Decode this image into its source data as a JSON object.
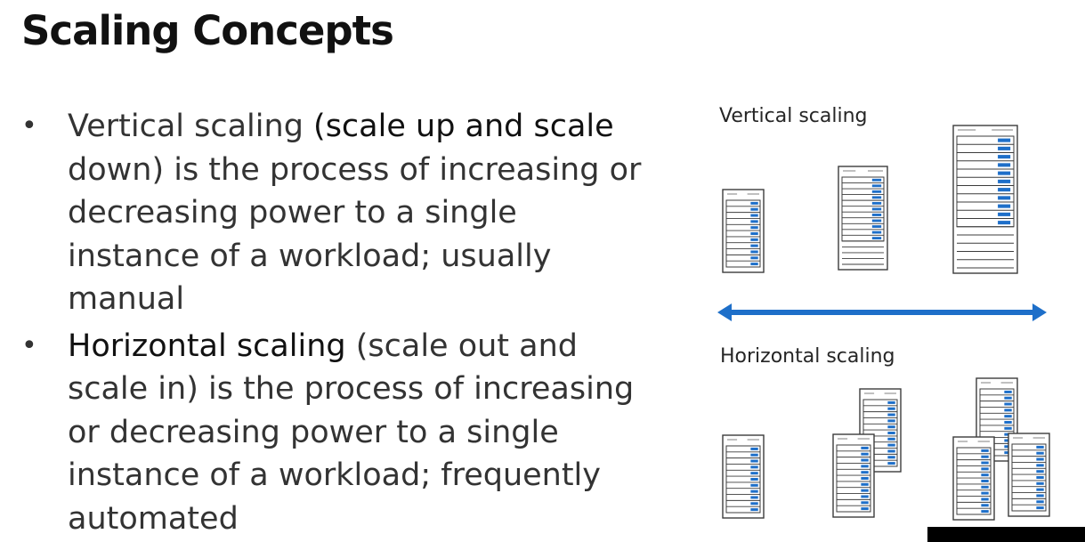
{
  "slide": {
    "title": "Scaling Concepts",
    "bullets": [
      {
        "lead": "Vertical scaling ",
        "term": "(scale up and scale",
        "rest": " down) is the process of increasing or decreasing power to a single instance of a workload; usually manual"
      },
      {
        "lead": "",
        "term": "Horizontal scaling",
        "rest": " (scale out and scale in) is the process of increasing or decreasing power to a single instance of a workload; frequently automated"
      }
    ],
    "bullet_glyph": "•"
  },
  "diagram": {
    "vertical_label": "Vertical scaling",
    "horizontal_label": "Horizontal scaling",
    "arrow_icon": "double-arrow-icon",
    "server_icon": "server-rack-icon",
    "accent": "#1e6fc9",
    "line_color": "#3c3c3c"
  }
}
